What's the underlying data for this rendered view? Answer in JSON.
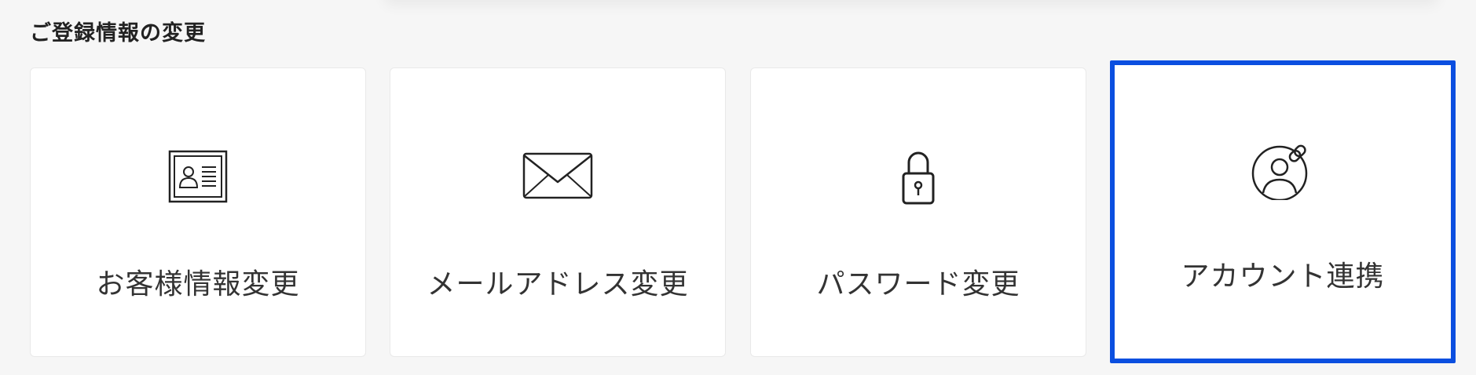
{
  "section": {
    "title": "ご登録情報の変更"
  },
  "cards": [
    {
      "label": "お客様情報変更",
      "icon": "id-card-icon"
    },
    {
      "label": "メールアドレス変更",
      "icon": "envelope-icon"
    },
    {
      "label": "パスワード変更",
      "icon": "padlock-icon"
    },
    {
      "label": "アカウント連携",
      "icon": "user-link-icon",
      "selected": true
    }
  ],
  "colors": {
    "selected_border": "#0b4fe0",
    "text": "#333333",
    "card_background": "#ffffff",
    "page_background": "#f6f6f6"
  }
}
